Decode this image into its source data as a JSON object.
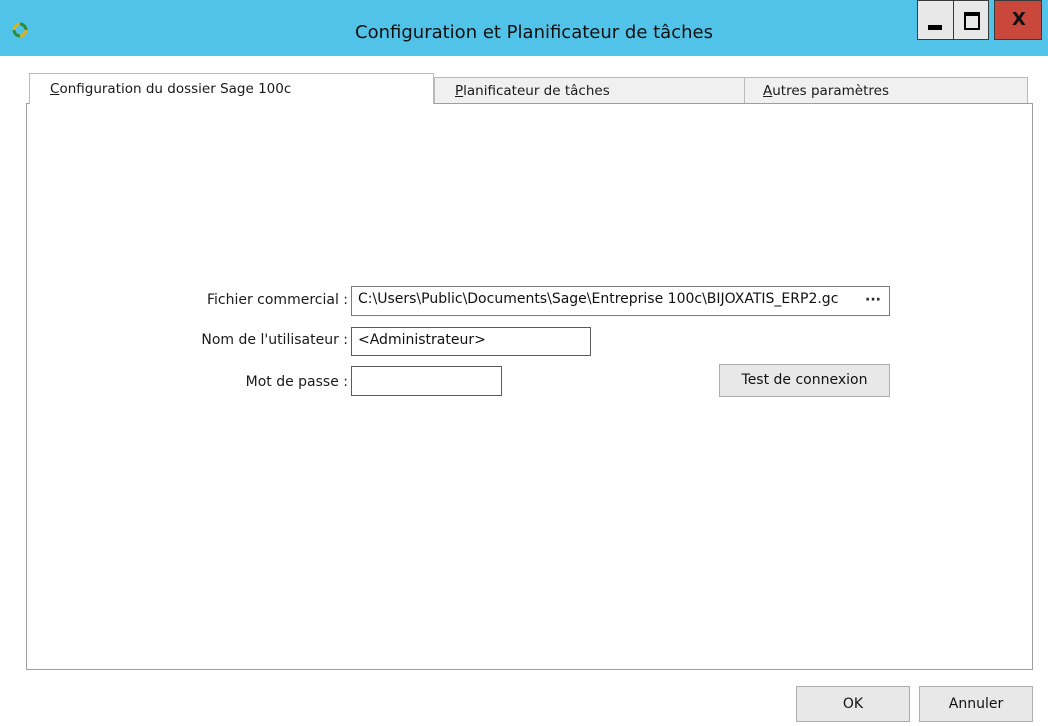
{
  "window": {
    "title": "Configuration et Planificateur de tâches",
    "close_glyph": "X"
  },
  "tabs": [
    {
      "mnemonic": "C",
      "rest": "onfiguration du dossier Sage 100c",
      "active": true
    },
    {
      "mnemonic": "P",
      "rest": "lanificateur de tâches",
      "active": false
    },
    {
      "mnemonic": "A",
      "rest": "utres paramètres",
      "active": false
    }
  ],
  "form": {
    "fichier_label": "Fichier commercial  :",
    "fichier_value": "C:\\Users\\Public\\Documents\\Sage\\Entreprise 100c\\BIJOXATIS_ERP2.gc",
    "browse_label": "···",
    "nom_label": "Nom de l'utilisateur :",
    "nom_value": "<Administrateur>",
    "mdp_label": "Mot de passe :",
    "mdp_value": "",
    "test_button": "Test de connexion"
  },
  "footer": {
    "ok_button": "OK",
    "cancel_button": "Annuler"
  },
  "colors": {
    "titlebar": "#52c3e8",
    "close_button": "#c9483b",
    "button_face": "#e8e8e8"
  },
  "icons": [
    "app-refresh-icon",
    "minimize-icon",
    "maximize-icon",
    "close-icon"
  ]
}
